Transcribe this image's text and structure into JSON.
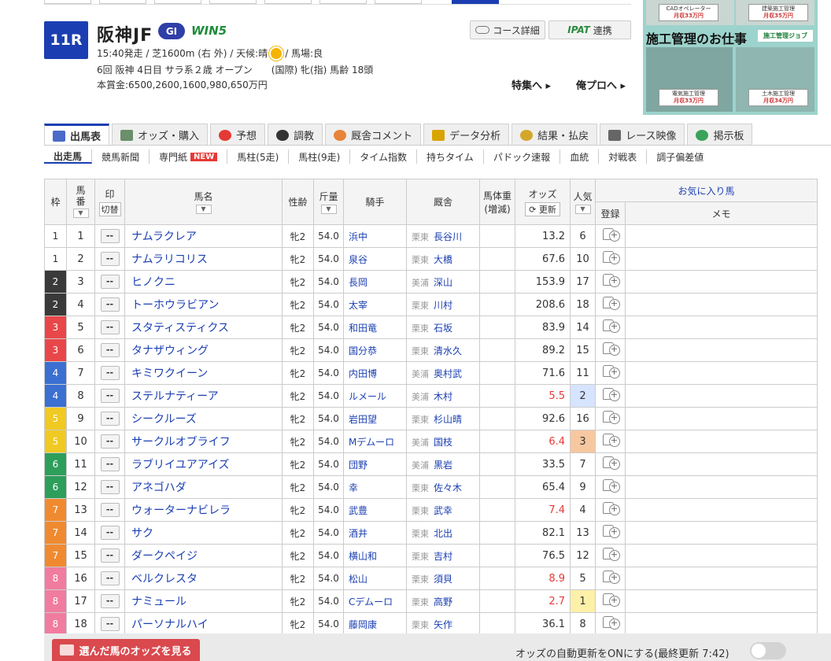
{
  "race": {
    "number": "11R",
    "title": "阪神JF",
    "grade": "GI",
    "win5": "WIN5",
    "info_line1_pre": "15:40発走 / 芝1600m (右 外) / 天候:晴",
    "info_line1_post": "/ 馬場:良",
    "info_line2": "6回 阪神 4日目 サラ系２歳 オープン　　(国際) 牝(指) 馬齢 18頭",
    "prize": "本賞金:6500,2600,1600,980,650万円"
  },
  "buttons": {
    "course": "コース詳細",
    "ipat_logo": "IPAT",
    "ipat": "連携",
    "tokushu": "特集へ ▸",
    "orepro": "俺プロへ ▸"
  },
  "ad": {
    "headline": "施工管理のお仕事",
    "logo": "施工管理ジョブ",
    "cards": [
      {
        "title": "CADオペレーター",
        "salary": "月収33万円"
      },
      {
        "title": "建築施工管理",
        "salary": "月収35万円"
      },
      {
        "title": "電気施工管理",
        "salary": "月収33万円"
      },
      {
        "title": "土木施工管理",
        "salary": "月収34万円"
      }
    ]
  },
  "tabs": [
    "出馬表",
    "オッズ・購入",
    "予想",
    "調教",
    "厩舎コメント",
    "データ分析",
    "結果・払戻",
    "レース映像",
    "掲示板"
  ],
  "subnav": [
    "出走馬",
    "競馬新聞",
    "専門紙",
    "馬柱(5走)",
    "馬柱(9走)",
    "タイム指数",
    "持ちタイム",
    "パドック速報",
    "血統",
    "対戦表",
    "調子偏差値"
  ],
  "subnav_new": "NEW",
  "table_headers": {
    "waku": "枠",
    "umaban": "馬番",
    "shirushi": "印",
    "kirikae": "切替",
    "name": "馬名",
    "sex": "性齢",
    "kin": "斤量",
    "jockey": "騎手",
    "stable": "厩舎",
    "weight1": "馬体重",
    "weight2": "(増減)",
    "odds": "オッズ",
    "update": "更新",
    "pop": "人気",
    "favorite": "お気に入り馬",
    "register": "登録",
    "memo": "メモ"
  },
  "horses": [
    {
      "waku": "1",
      "num": "1",
      "name": "ナムラクレア",
      "sex": "牝2",
      "kin": "54.0",
      "jockey": "浜中",
      "region": "栗東",
      "trainer": "長谷川",
      "odds": "13.2",
      "pop": "6"
    },
    {
      "waku": "1",
      "num": "2",
      "name": "ナムラリコリス",
      "sex": "牝2",
      "kin": "54.0",
      "jockey": "泉谷",
      "region": "栗東",
      "trainer": "大橋",
      "odds": "67.6",
      "pop": "10"
    },
    {
      "waku": "2",
      "num": "3",
      "name": "ヒノクニ",
      "sex": "牝2",
      "kin": "54.0",
      "jockey": "長岡",
      "region": "美浦",
      "trainer": "深山",
      "odds": "153.9",
      "pop": "17"
    },
    {
      "waku": "2",
      "num": "4",
      "name": "トーホウラビアン",
      "sex": "牝2",
      "kin": "54.0",
      "jockey": "太宰",
      "region": "栗東",
      "trainer": "川村",
      "odds": "208.6",
      "pop": "18"
    },
    {
      "waku": "3",
      "num": "5",
      "name": "スタティスティクス",
      "sex": "牝2",
      "kin": "54.0",
      "jockey": "和田竜",
      "region": "栗東",
      "trainer": "石坂",
      "odds": "83.9",
      "pop": "14"
    },
    {
      "waku": "3",
      "num": "6",
      "name": "タナザウィング",
      "sex": "牝2",
      "kin": "54.0",
      "jockey": "国分恭",
      "region": "栗東",
      "trainer": "清水久",
      "odds": "89.2",
      "pop": "15"
    },
    {
      "waku": "4",
      "num": "7",
      "name": "キミワクイーン",
      "sex": "牝2",
      "kin": "54.0",
      "jockey": "内田博",
      "region": "美浦",
      "trainer": "奥村武",
      "odds": "71.6",
      "pop": "11"
    },
    {
      "waku": "4",
      "num": "8",
      "name": "ステルナティーア",
      "sex": "牝2",
      "kin": "54.0",
      "jockey": "ルメール",
      "region": "美浦",
      "trainer": "木村",
      "odds": "5.5",
      "pop": "2"
    },
    {
      "waku": "5",
      "num": "9",
      "name": "シークルーズ",
      "sex": "牝2",
      "kin": "54.0",
      "jockey": "岩田望",
      "region": "栗東",
      "trainer": "杉山晴",
      "odds": "92.6",
      "pop": "16"
    },
    {
      "waku": "5",
      "num": "10",
      "name": "サークルオブライフ",
      "sex": "牝2",
      "kin": "54.0",
      "jockey": "Mデムーロ",
      "region": "美浦",
      "trainer": "国枝",
      "odds": "6.4",
      "pop": "3"
    },
    {
      "waku": "6",
      "num": "11",
      "name": "ラブリイユアアイズ",
      "sex": "牝2",
      "kin": "54.0",
      "jockey": "団野",
      "region": "美浦",
      "trainer": "黒岩",
      "odds": "33.5",
      "pop": "7"
    },
    {
      "waku": "6",
      "num": "12",
      "name": "アネゴハダ",
      "sex": "牝2",
      "kin": "54.0",
      "jockey": "幸",
      "region": "栗東",
      "trainer": "佐々木",
      "odds": "65.4",
      "pop": "9"
    },
    {
      "waku": "7",
      "num": "13",
      "name": "ウォーターナビレラ",
      "sex": "牝2",
      "kin": "54.0",
      "jockey": "武豊",
      "region": "栗東",
      "trainer": "武幸",
      "odds": "7.4",
      "pop": "4"
    },
    {
      "waku": "7",
      "num": "14",
      "name": "サク",
      "sex": "牝2",
      "kin": "54.0",
      "jockey": "酒井",
      "region": "栗東",
      "trainer": "北出",
      "odds": "82.1",
      "pop": "13"
    },
    {
      "waku": "7",
      "num": "15",
      "name": "ダークペイジ",
      "sex": "牝2",
      "kin": "54.0",
      "jockey": "横山和",
      "region": "栗東",
      "trainer": "吉村",
      "odds": "76.5",
      "pop": "12"
    },
    {
      "waku": "8",
      "num": "16",
      "name": "ベルクレスタ",
      "sex": "牝2",
      "kin": "54.0",
      "jockey": "松山",
      "region": "栗東",
      "trainer": "須貝",
      "odds": "8.9",
      "pop": "5"
    },
    {
      "waku": "8",
      "num": "17",
      "name": "ナミュール",
      "sex": "牝2",
      "kin": "54.0",
      "jockey": "Cデムーロ",
      "region": "栗東",
      "trainer": "高野",
      "odds": "2.7",
      "pop": "1"
    },
    {
      "waku": "8",
      "num": "18",
      "name": "パーソナルハイ",
      "sex": "牝2",
      "kin": "54.0",
      "jockey": "藤岡康",
      "region": "栗東",
      "trainer": "矢作",
      "odds": "36.1",
      "pop": "8"
    }
  ],
  "bottom": {
    "odds_button": "選んだ馬のオッズを見る",
    "auto_update": "オッズの自動更新をONにする(最終更新 7:42)"
  }
}
